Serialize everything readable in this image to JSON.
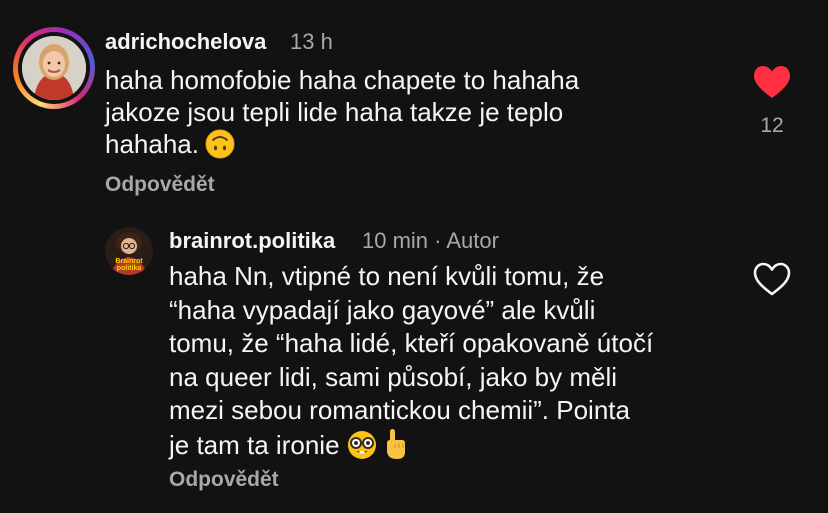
{
  "comments": [
    {
      "username": "adrichochelova",
      "time": "13 h",
      "lines": [
        "haha homofobie haha chapete to hahaha",
        "jakoze jsou tepli lide haha takze je teplo",
        "hahaha."
      ],
      "reply_label": "Odpovědět",
      "like_count": "12",
      "liked": true,
      "emoji": "upside-down-face"
    },
    {
      "username": "brainrot.politika",
      "time": "10 min · Autor",
      "lines": [
        "haha Nn, vtipné to není kvůli tomu, že",
        "“haha vypadají jako gayové” ale kvůli",
        "tomu, že “haha lidé, kteří opakovaně útočí",
        "na queer lidi, sami působí, jako by měli",
        "mezi sebou romantickou chemii”. Pointa",
        "je tam ta ironie"
      ],
      "reply_label": "Odpovědět",
      "liked": false,
      "avatar_text": [
        "Brainrot",
        "politika"
      ],
      "emojis": [
        "nerd-face",
        "backhand-index-pointing-up"
      ]
    }
  ],
  "colors": {
    "background": "#121212",
    "text": "#f5f5f5",
    "muted": "#a8a8a8",
    "like": "#ff3040"
  }
}
